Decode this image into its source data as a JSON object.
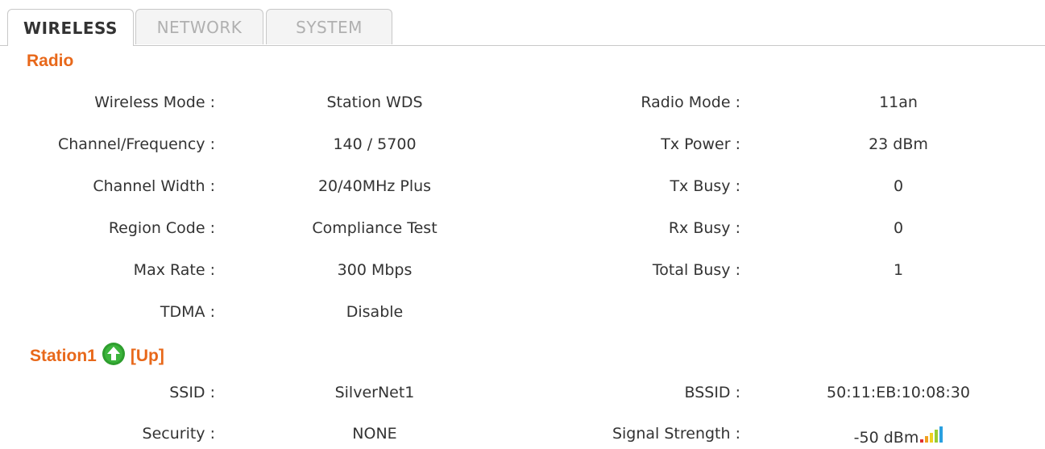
{
  "tabs": [
    {
      "label": "WIRELESS",
      "active": true
    },
    {
      "label": "NETWORK",
      "active": false
    },
    {
      "label": "SYSTEM",
      "active": false
    }
  ],
  "radio": {
    "title": "Radio",
    "rows": [
      {
        "label1": "Wireless Mode :",
        "value1": "Station WDS",
        "label2": "Radio Mode :",
        "value2": "11an"
      },
      {
        "label1": "Channel/Frequency :",
        "value1": "140 / 5700",
        "label2": "Tx Power :",
        "value2": "23 dBm"
      },
      {
        "label1": "Channel Width :",
        "value1": "20/40MHz Plus",
        "label2": "Tx Busy :",
        "value2": "0"
      },
      {
        "label1": "Region Code :",
        "value1": "Compliance Test",
        "label2": "Rx Busy :",
        "value2": "0"
      },
      {
        "label1": "Max Rate :",
        "value1": "300 Mbps",
        "label2": "Total Busy :",
        "value2": "1"
      },
      {
        "label1": "TDMA :",
        "value1": "Disable"
      }
    ]
  },
  "station": {
    "title": "Station1",
    "status": "[Up]",
    "status_icon": "arrow-up-circle-icon",
    "status_color": "#2e9e2e",
    "rows": [
      {
        "label1": "SSID :",
        "value1": "SilverNet1",
        "label2": "BSSID :",
        "value2": "50:11:EB:10:08:30"
      },
      {
        "label1": "Security :",
        "value1": "NONE",
        "label2": "Signal Strength :",
        "value2": "-50 dBm"
      }
    ],
    "signal_bars": [
      "#e03030",
      "#f0a020",
      "#f0d020",
      "#9acd32",
      "#2aa0e0"
    ]
  },
  "colors": {
    "accent": "#e8681a",
    "text": "#333333",
    "inactive_tab": "#b0b0b0"
  }
}
